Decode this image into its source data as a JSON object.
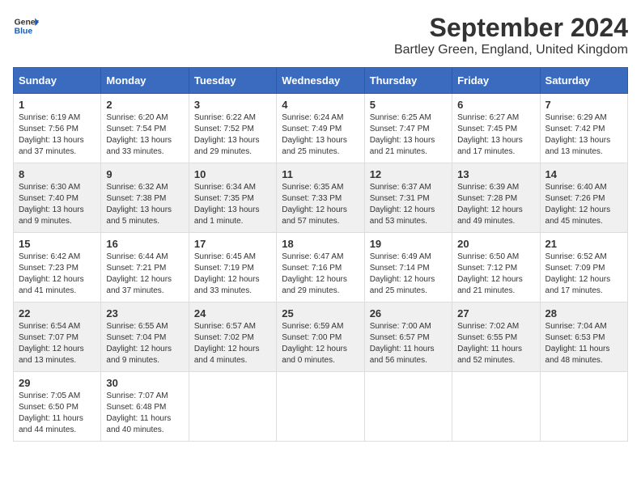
{
  "header": {
    "logo_line1": "General",
    "logo_line2": "Blue",
    "title": "September 2024",
    "subtitle": "Bartley Green, England, United Kingdom"
  },
  "calendar": {
    "days_of_week": [
      "Sunday",
      "Monday",
      "Tuesday",
      "Wednesday",
      "Thursday",
      "Friday",
      "Saturday"
    ],
    "weeks": [
      [
        {
          "day": "1",
          "sunrise": "Sunrise: 6:19 AM",
          "sunset": "Sunset: 7:56 PM",
          "daylight": "Daylight: 13 hours and 37 minutes."
        },
        {
          "day": "2",
          "sunrise": "Sunrise: 6:20 AM",
          "sunset": "Sunset: 7:54 PM",
          "daylight": "Daylight: 13 hours and 33 minutes."
        },
        {
          "day": "3",
          "sunrise": "Sunrise: 6:22 AM",
          "sunset": "Sunset: 7:52 PM",
          "daylight": "Daylight: 13 hours and 29 minutes."
        },
        {
          "day": "4",
          "sunrise": "Sunrise: 6:24 AM",
          "sunset": "Sunset: 7:49 PM",
          "daylight": "Daylight: 13 hours and 25 minutes."
        },
        {
          "day": "5",
          "sunrise": "Sunrise: 6:25 AM",
          "sunset": "Sunset: 7:47 PM",
          "daylight": "Daylight: 13 hours and 21 minutes."
        },
        {
          "day": "6",
          "sunrise": "Sunrise: 6:27 AM",
          "sunset": "Sunset: 7:45 PM",
          "daylight": "Daylight: 13 hours and 17 minutes."
        },
        {
          "day": "7",
          "sunrise": "Sunrise: 6:29 AM",
          "sunset": "Sunset: 7:42 PM",
          "daylight": "Daylight: 13 hours and 13 minutes."
        }
      ],
      [
        {
          "day": "8",
          "sunrise": "Sunrise: 6:30 AM",
          "sunset": "Sunset: 7:40 PM",
          "daylight": "Daylight: 13 hours and 9 minutes."
        },
        {
          "day": "9",
          "sunrise": "Sunrise: 6:32 AM",
          "sunset": "Sunset: 7:38 PM",
          "daylight": "Daylight: 13 hours and 5 minutes."
        },
        {
          "day": "10",
          "sunrise": "Sunrise: 6:34 AM",
          "sunset": "Sunset: 7:35 PM",
          "daylight": "Daylight: 13 hours and 1 minute."
        },
        {
          "day": "11",
          "sunrise": "Sunrise: 6:35 AM",
          "sunset": "Sunset: 7:33 PM",
          "daylight": "Daylight: 12 hours and 57 minutes."
        },
        {
          "day": "12",
          "sunrise": "Sunrise: 6:37 AM",
          "sunset": "Sunset: 7:31 PM",
          "daylight": "Daylight: 12 hours and 53 minutes."
        },
        {
          "day": "13",
          "sunrise": "Sunrise: 6:39 AM",
          "sunset": "Sunset: 7:28 PM",
          "daylight": "Daylight: 12 hours and 49 minutes."
        },
        {
          "day": "14",
          "sunrise": "Sunrise: 6:40 AM",
          "sunset": "Sunset: 7:26 PM",
          "daylight": "Daylight: 12 hours and 45 minutes."
        }
      ],
      [
        {
          "day": "15",
          "sunrise": "Sunrise: 6:42 AM",
          "sunset": "Sunset: 7:23 PM",
          "daylight": "Daylight: 12 hours and 41 minutes."
        },
        {
          "day": "16",
          "sunrise": "Sunrise: 6:44 AM",
          "sunset": "Sunset: 7:21 PM",
          "daylight": "Daylight: 12 hours and 37 minutes."
        },
        {
          "day": "17",
          "sunrise": "Sunrise: 6:45 AM",
          "sunset": "Sunset: 7:19 PM",
          "daylight": "Daylight: 12 hours and 33 minutes."
        },
        {
          "day": "18",
          "sunrise": "Sunrise: 6:47 AM",
          "sunset": "Sunset: 7:16 PM",
          "daylight": "Daylight: 12 hours and 29 minutes."
        },
        {
          "day": "19",
          "sunrise": "Sunrise: 6:49 AM",
          "sunset": "Sunset: 7:14 PM",
          "daylight": "Daylight: 12 hours and 25 minutes."
        },
        {
          "day": "20",
          "sunrise": "Sunrise: 6:50 AM",
          "sunset": "Sunset: 7:12 PM",
          "daylight": "Daylight: 12 hours and 21 minutes."
        },
        {
          "day": "21",
          "sunrise": "Sunrise: 6:52 AM",
          "sunset": "Sunset: 7:09 PM",
          "daylight": "Daylight: 12 hours and 17 minutes."
        }
      ],
      [
        {
          "day": "22",
          "sunrise": "Sunrise: 6:54 AM",
          "sunset": "Sunset: 7:07 PM",
          "daylight": "Daylight: 12 hours and 13 minutes."
        },
        {
          "day": "23",
          "sunrise": "Sunrise: 6:55 AM",
          "sunset": "Sunset: 7:04 PM",
          "daylight": "Daylight: 12 hours and 9 minutes."
        },
        {
          "day": "24",
          "sunrise": "Sunrise: 6:57 AM",
          "sunset": "Sunset: 7:02 PM",
          "daylight": "Daylight: 12 hours and 4 minutes."
        },
        {
          "day": "25",
          "sunrise": "Sunrise: 6:59 AM",
          "sunset": "Sunset: 7:00 PM",
          "daylight": "Daylight: 12 hours and 0 minutes."
        },
        {
          "day": "26",
          "sunrise": "Sunrise: 7:00 AM",
          "sunset": "Sunset: 6:57 PM",
          "daylight": "Daylight: 11 hours and 56 minutes."
        },
        {
          "day": "27",
          "sunrise": "Sunrise: 7:02 AM",
          "sunset": "Sunset: 6:55 PM",
          "daylight": "Daylight: 11 hours and 52 minutes."
        },
        {
          "day": "28",
          "sunrise": "Sunrise: 7:04 AM",
          "sunset": "Sunset: 6:53 PM",
          "daylight": "Daylight: 11 hours and 48 minutes."
        }
      ],
      [
        {
          "day": "29",
          "sunrise": "Sunrise: 7:05 AM",
          "sunset": "Sunset: 6:50 PM",
          "daylight": "Daylight: 11 hours and 44 minutes."
        },
        {
          "day": "30",
          "sunrise": "Sunrise: 7:07 AM",
          "sunset": "Sunset: 6:48 PM",
          "daylight": "Daylight: 11 hours and 40 minutes."
        },
        null,
        null,
        null,
        null,
        null
      ]
    ]
  }
}
